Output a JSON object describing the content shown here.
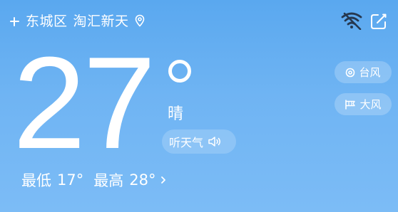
{
  "header": {
    "district": "东城区",
    "place": "淘汇新天"
  },
  "current": {
    "temperature": "27",
    "condition": "晴",
    "listen_label": "听天气",
    "min_label": "最低",
    "min_temp": "17°",
    "max_label": "最高",
    "max_temp": "28°"
  },
  "alerts": [
    {
      "label": "台风",
      "icon": "typhoon-icon"
    },
    {
      "label": "大风",
      "icon": "wind-flag-icon"
    }
  ],
  "icons": [
    "add-icon",
    "location-pin-icon",
    "wifi-off-icon",
    "edit-icon",
    "speaker-icon",
    "chevron-right-icon"
  ],
  "colors": {
    "background_top": "#5aa8ef",
    "background_bottom": "#7cbcf6",
    "text": "#ffffff"
  }
}
